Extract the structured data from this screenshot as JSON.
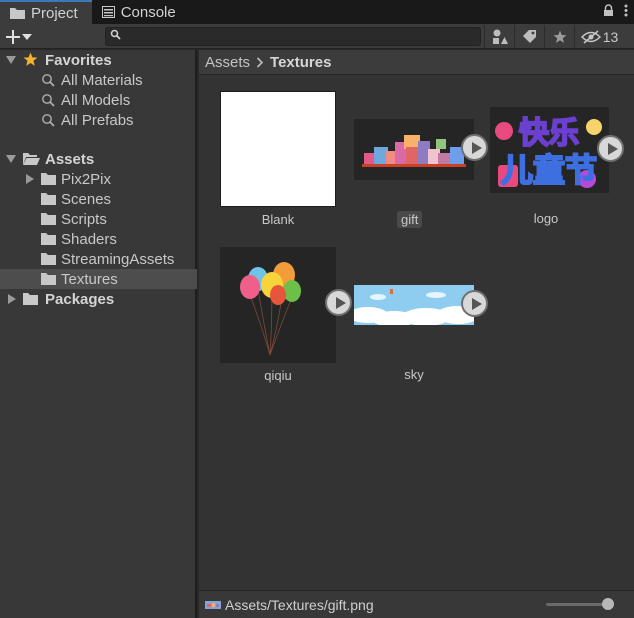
{
  "tabs": [
    {
      "label": "Project",
      "active": true,
      "icon": "folder-icon"
    },
    {
      "label": "Console",
      "active": false,
      "icon": "console-icon"
    }
  ],
  "tab_actions": {
    "lock_icon": "lock-icon",
    "menu_icon": "kebab-menu-icon"
  },
  "toolbar": {
    "add_icon": "plus-icon",
    "search_placeholder": "",
    "search_value": "",
    "hidden_count": "13"
  },
  "sidebar": {
    "favorites": {
      "label": "Favorites",
      "items": [
        {
          "label": "All Materials"
        },
        {
          "label": "All Models"
        },
        {
          "label": "All Prefabs"
        }
      ]
    },
    "assets": {
      "label": "Assets",
      "items": [
        {
          "label": "Pix2Pix",
          "expandable": true
        },
        {
          "label": "Scenes",
          "expandable": false
        },
        {
          "label": "Scripts",
          "expandable": false
        },
        {
          "label": "Shaders",
          "expandable": false
        },
        {
          "label": "StreamingAssets",
          "expandable": false
        },
        {
          "label": "Textures",
          "expandable": false,
          "selected": true
        }
      ]
    },
    "packages": {
      "label": "Packages"
    }
  },
  "breadcrumb": {
    "root": "Assets",
    "current": "Textures"
  },
  "assets": [
    {
      "name": "Blank",
      "selected": false,
      "has_play": false
    },
    {
      "name": "gift",
      "selected": true,
      "has_play": true
    },
    {
      "name": "logo",
      "selected": false,
      "has_play": true
    },
    {
      "name": "qiqiu",
      "selected": false,
      "has_play": true
    },
    {
      "name": "sky",
      "selected": false,
      "has_play": true
    }
  ],
  "logo_text": "快乐儿童节",
  "status": {
    "path": "Assets/Textures/gift.png",
    "zoom": 0.92
  },
  "colors": {
    "accent": "#3a79bb",
    "star": "#f0b32c",
    "background": "#282828"
  }
}
